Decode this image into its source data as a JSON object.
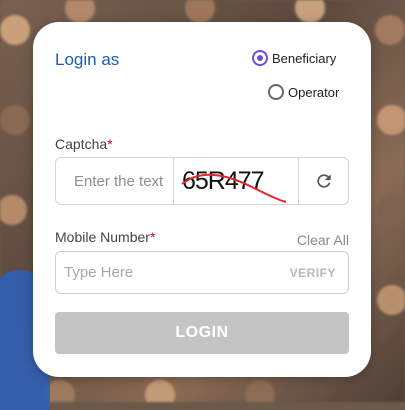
{
  "login": {
    "title": "Login as",
    "roles": [
      {
        "label": "Beneficiary",
        "selected": true
      },
      {
        "label": "Operator",
        "selected": false
      }
    ],
    "captcha": {
      "label": "Captcha",
      "required_mark": "*",
      "placeholder": "Enter the text",
      "image_text": "65R477",
      "refresh_icon": "refresh-icon"
    },
    "mobile": {
      "label": "Mobile Number",
      "required_mark": "*",
      "clear_label": "Clear All",
      "placeholder": "Type Here",
      "verify_label": "VERIFY"
    },
    "submit_label": "LOGIN"
  },
  "colors": {
    "title": "#1a5fb4",
    "radio_accent": "#6b4fd8",
    "required": "#d0021b",
    "button_disabled": "#c4c4c4",
    "captcha_strike": "#e0262e"
  }
}
